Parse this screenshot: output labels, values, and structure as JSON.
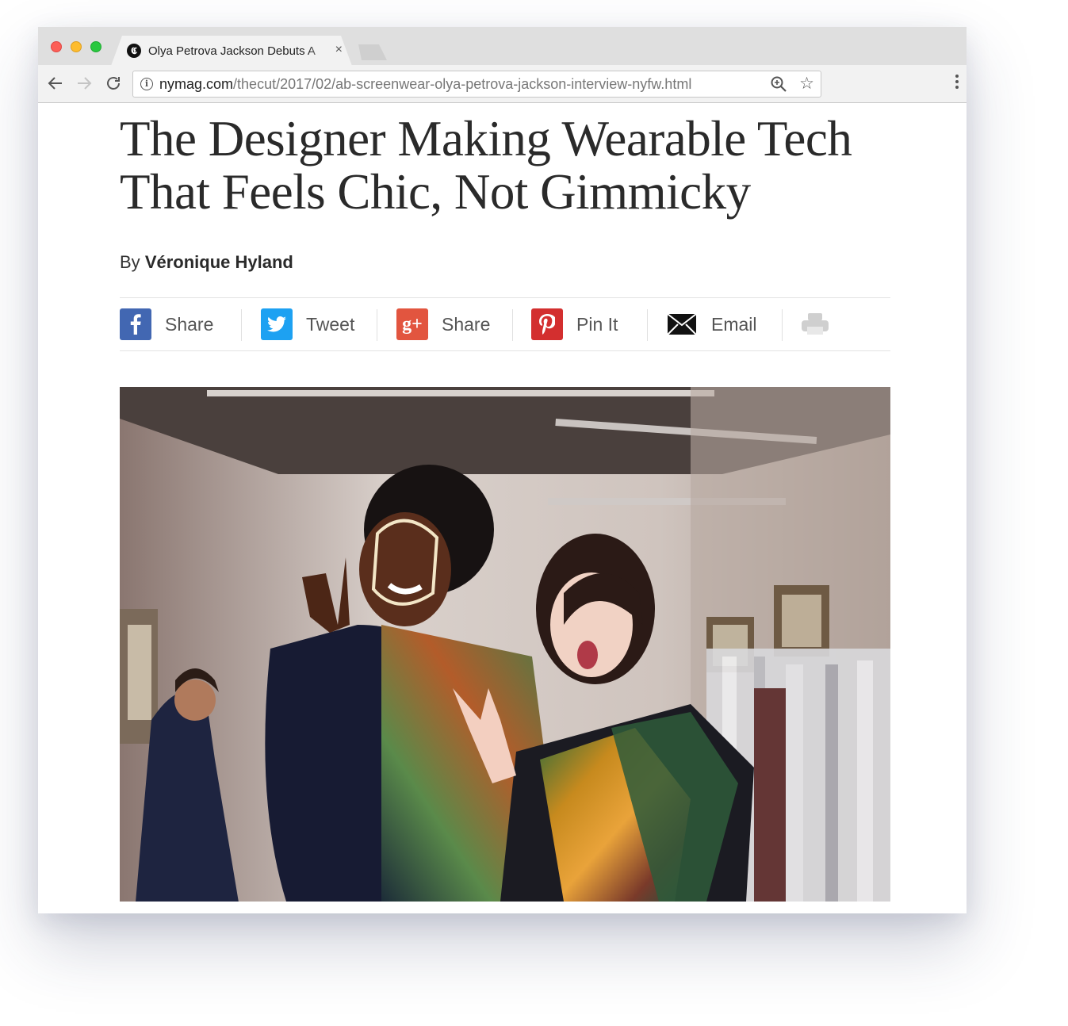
{
  "browser": {
    "tab": {
      "title": "Olya Petrova Jackson Debuts A",
      "close": "×",
      "favicon": "𝕮"
    },
    "url": {
      "host": "nymag.com",
      "path": "/thecut/2017/02/ab-screenwear-olya-petrova-jackson-interview-nyfw.html"
    }
  },
  "article": {
    "headline": "The Designer Making Wearable Tech That Feels Chic, Not Gimmicky",
    "byline_prefix": "By",
    "author": "Véronique Hyland"
  },
  "share": [
    {
      "label": "Share",
      "icon": "facebook-icon",
      "color": "#3b5998"
    },
    {
      "label": "Tweet",
      "icon": "twitter-icon",
      "color": "#1da1f2"
    },
    {
      "label": "Share",
      "icon": "google-plus-icon",
      "color": "#dd4b39"
    },
    {
      "label": "Pin It",
      "icon": "pinterest-icon",
      "color": "#cb2027"
    },
    {
      "label": "Email",
      "icon": "email-icon",
      "color": "#111111"
    },
    {
      "label": "",
      "icon": "print-icon",
      "color": "#cfcfcf"
    }
  ]
}
